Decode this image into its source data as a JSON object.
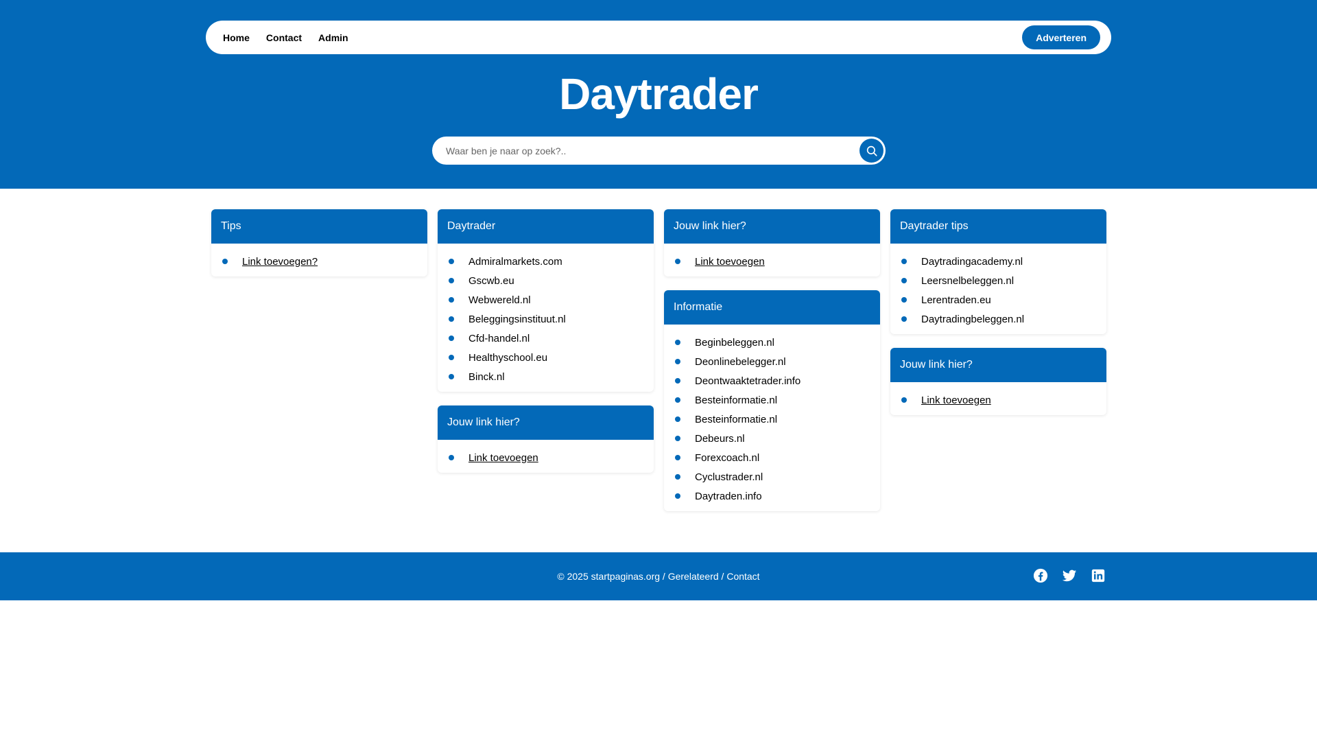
{
  "nav": {
    "links": [
      "Home",
      "Contact",
      "Admin"
    ],
    "cta": "Adverteren"
  },
  "page_title": "Daytrader",
  "search": {
    "placeholder": "Waar ben je naar op zoek?.."
  },
  "columns": [
    {
      "cards": [
        {
          "title": "Tips",
          "links": [
            {
              "text": "Link toevoegen?",
              "underlined": true
            }
          ]
        }
      ]
    },
    {
      "cards": [
        {
          "title": "Daytrader",
          "links": [
            {
              "text": "Admiralmarkets.com"
            },
            {
              "text": "Gscwb.eu"
            },
            {
              "text": "Webwereld.nl"
            },
            {
              "text": "Beleggingsinstituut.nl"
            },
            {
              "text": "Cfd-handel.nl"
            },
            {
              "text": "Healthyschool.eu"
            },
            {
              "text": "Binck.nl"
            }
          ]
        },
        {
          "title": "Jouw link hier?",
          "links": [
            {
              "text": "Link toevoegen",
              "underlined": true
            }
          ]
        }
      ]
    },
    {
      "cards": [
        {
          "title": "Jouw link hier?",
          "links": [
            {
              "text": "Link toevoegen",
              "underlined": true
            }
          ]
        },
        {
          "title": "Informatie",
          "links": [
            {
              "text": "Beginbeleggen.nl"
            },
            {
              "text": "Deonlinebelegger.nl"
            },
            {
              "text": "Deontwaaktetrader.info"
            },
            {
              "text": "Besteinformatie.nl"
            },
            {
              "text": "Besteinformatie.nl"
            },
            {
              "text": "Debeurs.nl"
            },
            {
              "text": "Forexcoach.nl"
            },
            {
              "text": "Cyclustrader.nl"
            },
            {
              "text": "Daytraden.info"
            }
          ]
        }
      ]
    },
    {
      "cards": [
        {
          "title": "Daytrader tips",
          "links": [
            {
              "text": "Daytradingacademy.nl"
            },
            {
              "text": "Leersnelbeleggen.nl"
            },
            {
              "text": "Lerentraden.eu"
            },
            {
              "text": "Daytradingbeleggen.nl"
            }
          ]
        },
        {
          "title": "Jouw link hier?",
          "links": [
            {
              "text": "Link toevoegen",
              "underlined": true
            }
          ]
        }
      ]
    }
  ],
  "footer": {
    "copyright": "© 2025 startpaginas.org",
    "sep1": " / ",
    "related": "Gerelateerd",
    "sep2": " / ",
    "contact": "Contact",
    "socials": [
      "facebook-icon",
      "twitter-icon",
      "linkedin-icon"
    ]
  },
  "colors": {
    "primary": "#0369b8",
    "background": "#ffffff"
  }
}
